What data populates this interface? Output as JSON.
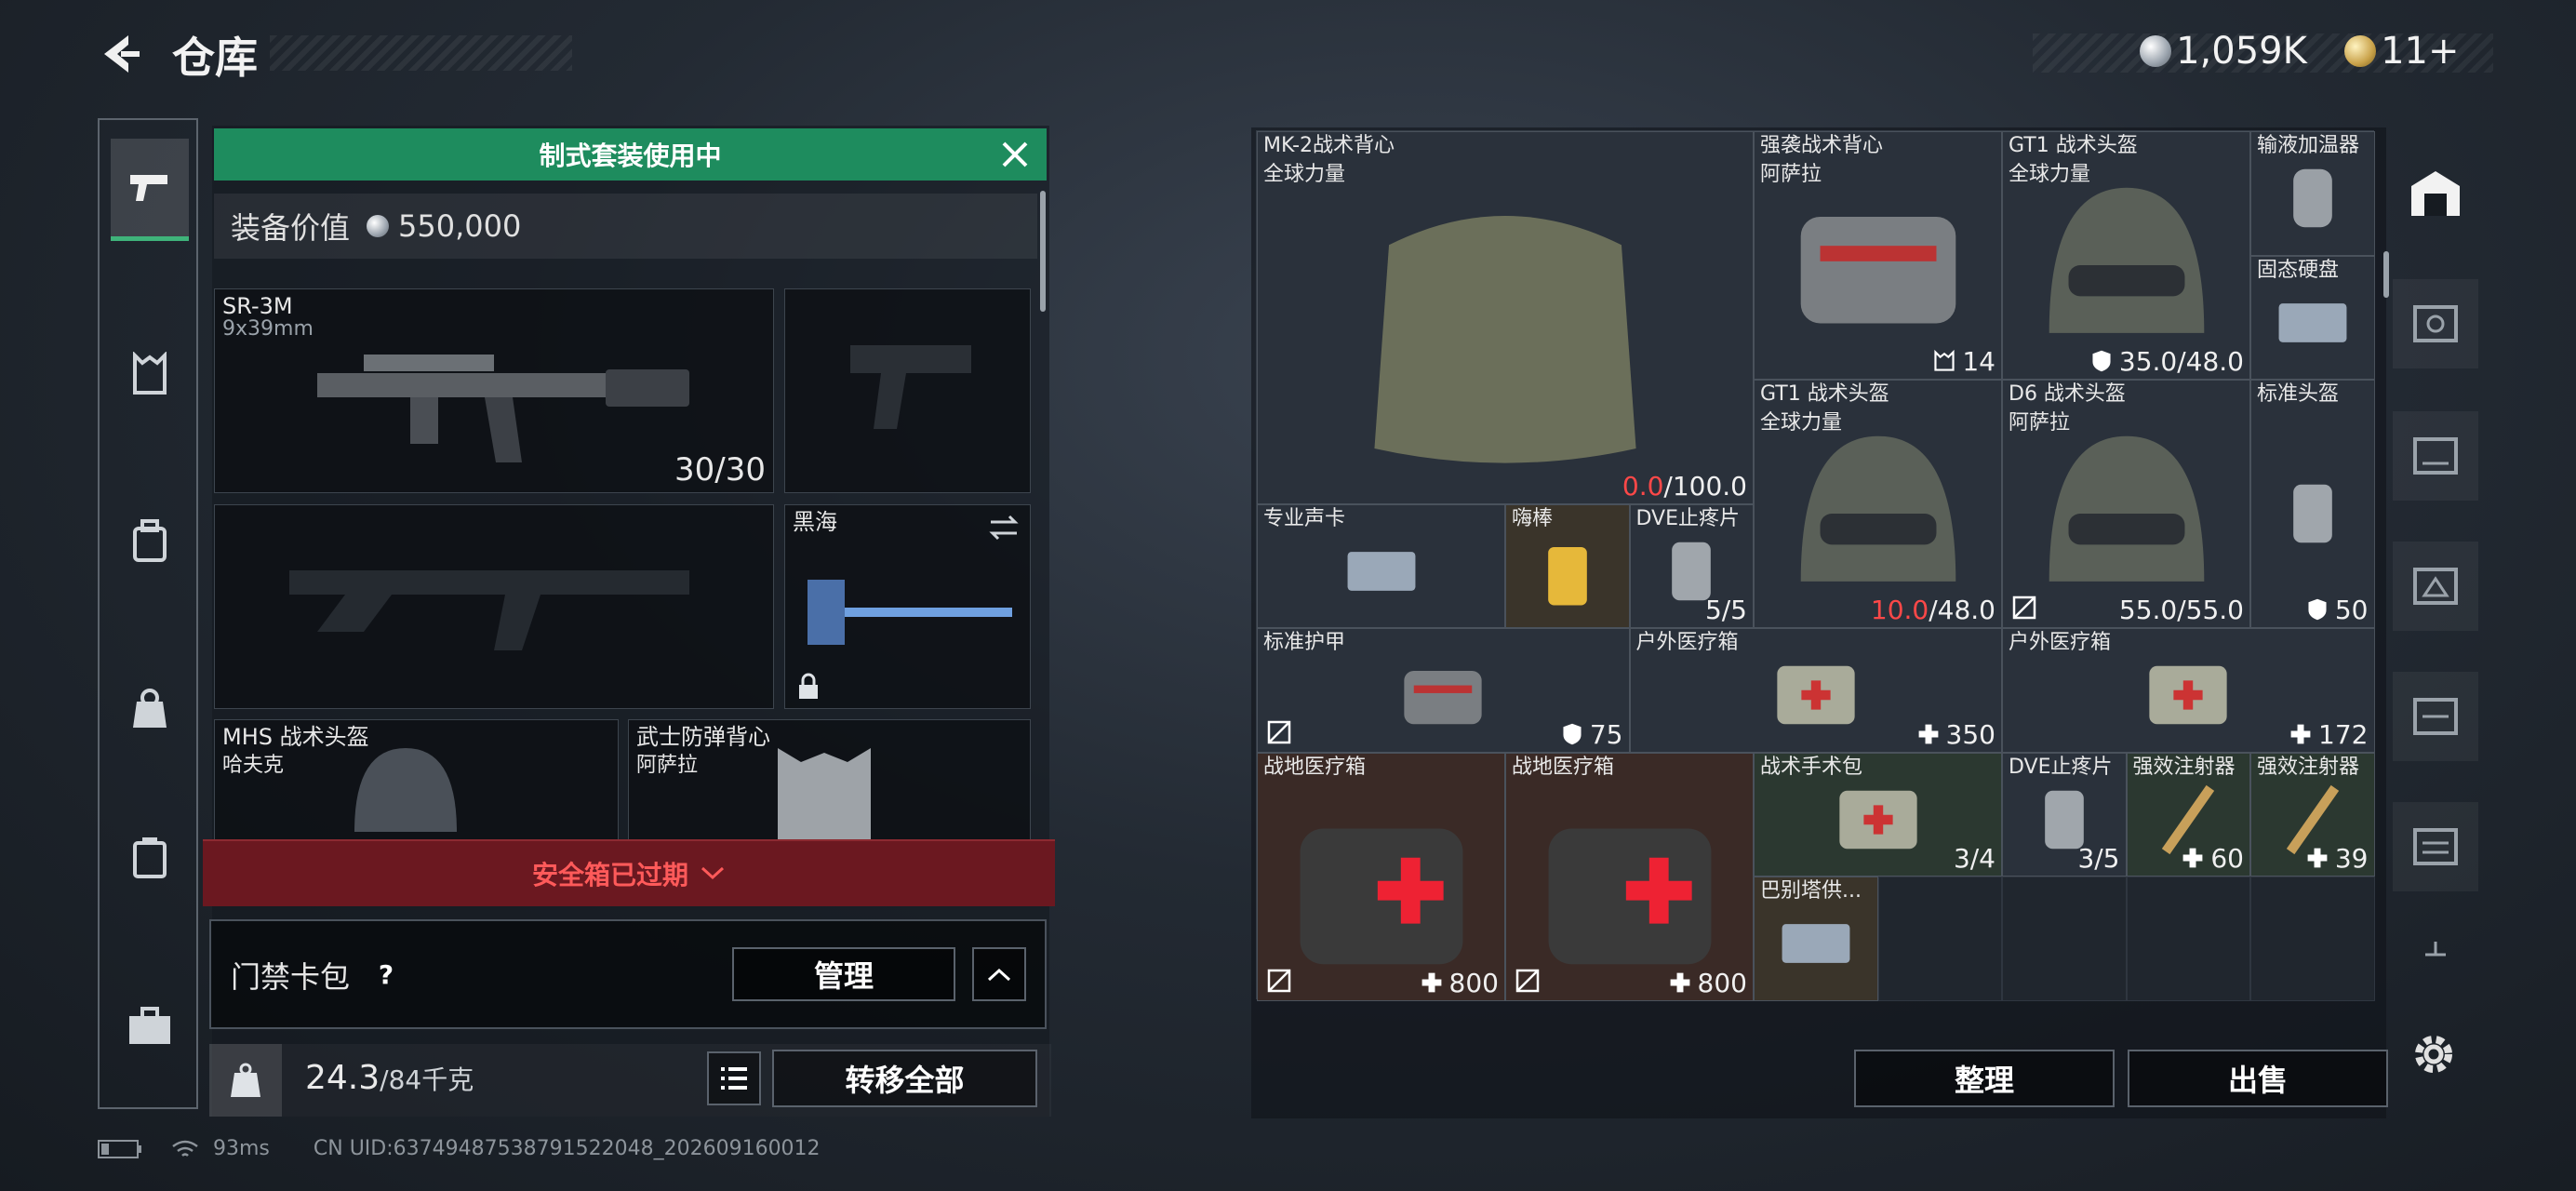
{
  "header": {
    "title": "仓库"
  },
  "currency": {
    "silver": "1,059K",
    "gold": "11+"
  },
  "left": {
    "banner": "制式套装使用中",
    "value_label": "装备价值",
    "value": "550,000",
    "slots": {
      "primary": {
        "name": "SR-3M",
        "sub": "9x39mm",
        "count": "30/30"
      },
      "melee": {
        "name": "黑海"
      },
      "helmet": {
        "name": "MHS 战术头盔",
        "sub": "哈夫克"
      },
      "vest": {
        "name": "武士防弹背心",
        "sub": "阿萨拉"
      }
    },
    "expired": "安全箱已过期",
    "keycard": {
      "label": "门禁卡包",
      "help": "?",
      "manage": "管理"
    },
    "weight": {
      "current": "24.3",
      "max": "/84千克",
      "transfer": "转移全部"
    }
  },
  "status": {
    "ping": "93ms",
    "uid": "CN UID:6374948753879152204​8_202609160012"
  },
  "items": [
    {
      "name": "MK-2战术背心",
      "sub": "全球力量",
      "val_red": "0.0",
      "val": "/100.0"
    },
    {
      "name": "强袭战术背心",
      "sub": "阿萨拉",
      "val": "14"
    },
    {
      "name": "GT1 战术头盔",
      "sub": "全球力量",
      "val": "35.0/48.0"
    },
    {
      "name": "输液加温器",
      "sub": "",
      "val": ""
    },
    {
      "name": "固态硬盘",
      "sub": "",
      "val": ""
    },
    {
      "name": "GT1 战术头盔",
      "sub": "全球力量",
      "val_red": "10.0",
      "val": "/48.0"
    },
    {
      "name": "D6 战术头盔",
      "sub": "阿萨拉",
      "val": "55.0/55.0"
    },
    {
      "name": "标准头盔",
      "sub": "",
      "val": "50"
    },
    {
      "name": "专业声卡",
      "sub": "",
      "val": ""
    },
    {
      "name": "嗨棒",
      "sub": "",
      "val": ""
    },
    {
      "name": "DVE止疼片",
      "sub": "",
      "val": "5/5"
    },
    {
      "name": "标准护甲",
      "sub": "",
      "val": "75"
    },
    {
      "name": "户外医疗箱",
      "sub": "",
      "val": "350"
    },
    {
      "name": "户外医疗箱",
      "sub": "",
      "val": "172"
    },
    {
      "name": "战地医疗箱",
      "sub": "",
      "val": "800"
    },
    {
      "name": "战地医疗箱",
      "sub": "",
      "val": "800"
    },
    {
      "name": "战术手术包",
      "sub": "",
      "val": "3/4"
    },
    {
      "name": "DVE止疼片",
      "sub": "",
      "val": "3/5"
    },
    {
      "name": "强效注射器",
      "sub": "",
      "val": "60"
    },
    {
      "name": "强效注射器",
      "sub": "",
      "val": "39"
    },
    {
      "name": "巴别塔供...",
      "sub": "",
      "val": ""
    }
  ],
  "actions": {
    "sort": "整理",
    "sell": "出售"
  }
}
